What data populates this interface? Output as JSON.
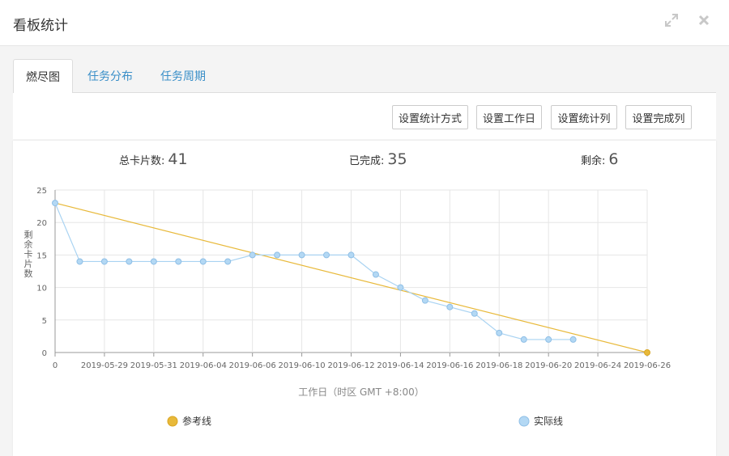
{
  "window": {
    "title": "看板统计",
    "icons": {
      "expand": "expand-icon",
      "close": "close-icon"
    }
  },
  "tabs": [
    {
      "label": "燃尽图",
      "active": true
    },
    {
      "label": "任务分布",
      "active": false
    },
    {
      "label": "任务周期",
      "active": false
    }
  ],
  "toolbar": {
    "buttons": [
      "设置统计方式",
      "设置工作日",
      "设置统计列",
      "设置完成列"
    ]
  },
  "stats": {
    "total_label": "总卡片数:",
    "total_value": "41",
    "done_label": "已完成:",
    "done_value": "35",
    "remaining_label": "剩余:",
    "remaining_value": "6"
  },
  "colors": {
    "reference": "#e8b93a",
    "actual": "#a9d3f2",
    "actual_marker_fill": "#b3d8f4",
    "actual_marker_stroke": "#8fbfe6",
    "tab_link": "#3a8fc8"
  },
  "chart_data": {
    "type": "line",
    "xlabel": "工作日（时区 GMT +8:00）",
    "ylabel": "剩余卡片数",
    "ylim": [
      0,
      25
    ],
    "y_ticks": [
      0,
      5,
      10,
      15,
      20,
      25
    ],
    "x_range_index": [
      0,
      24
    ],
    "x_tick_labels": [
      {
        "i": 0,
        "label": "0"
      },
      {
        "i": 2,
        "label": "2019-05-29"
      },
      {
        "i": 4,
        "label": "2019-05-31"
      },
      {
        "i": 6,
        "label": "2019-06-04"
      },
      {
        "i": 8,
        "label": "2019-06-06"
      },
      {
        "i": 10,
        "label": "2019-06-10"
      },
      {
        "i": 12,
        "label": "2019-06-12"
      },
      {
        "i": 14,
        "label": "2019-06-14"
      },
      {
        "i": 16,
        "label": "2019-06-16"
      },
      {
        "i": 18,
        "label": "2019-06-18"
      },
      {
        "i": 20,
        "label": "2019-06-20"
      },
      {
        "i": 22,
        "label": "2019-06-24"
      },
      {
        "i": 24,
        "label": "2019-06-26"
      }
    ],
    "grid": true,
    "legend_placement": "bottom",
    "series": [
      {
        "name": "参考线",
        "points": [
          [
            0,
            23
          ],
          [
            24,
            0
          ]
        ],
        "marker_indices": [
          1
        ]
      },
      {
        "name": "实际线",
        "points": [
          [
            0,
            23
          ],
          [
            1,
            14
          ],
          [
            2,
            14
          ],
          [
            3,
            14
          ],
          [
            4,
            14
          ],
          [
            5,
            14
          ],
          [
            6,
            14
          ],
          [
            7,
            14
          ],
          [
            8,
            15
          ],
          [
            9,
            15
          ],
          [
            10,
            15
          ],
          [
            11,
            15
          ],
          [
            12,
            15
          ],
          [
            13,
            12
          ],
          [
            14,
            10
          ],
          [
            15,
            8
          ],
          [
            16,
            7
          ],
          [
            17,
            6
          ],
          [
            18,
            3
          ],
          [
            19,
            2
          ],
          [
            20,
            2
          ],
          [
            21,
            2
          ]
        ]
      }
    ]
  }
}
